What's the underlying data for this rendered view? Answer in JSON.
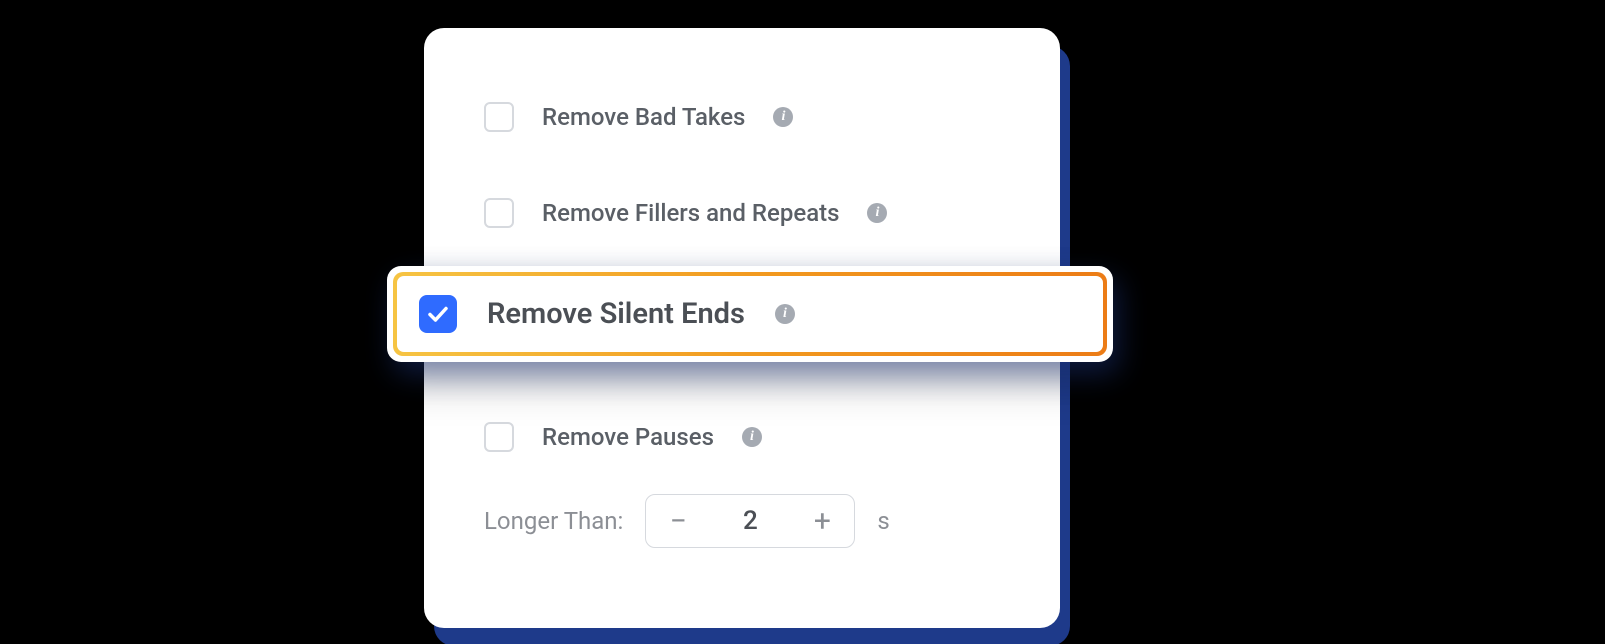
{
  "options": {
    "bad_takes": {
      "label": "Remove Bad Takes",
      "checked": false
    },
    "fillers": {
      "label": "Remove Fillers and Repeats",
      "checked": false
    },
    "silent_ends": {
      "label": "Remove Silent Ends",
      "checked": true
    },
    "pauses": {
      "label": "Remove Pauses",
      "checked": false
    }
  },
  "stepper": {
    "label": "Longer Than:",
    "value": "2",
    "unit": "s",
    "minus": "−",
    "plus": "+"
  },
  "info_glyph": "i"
}
